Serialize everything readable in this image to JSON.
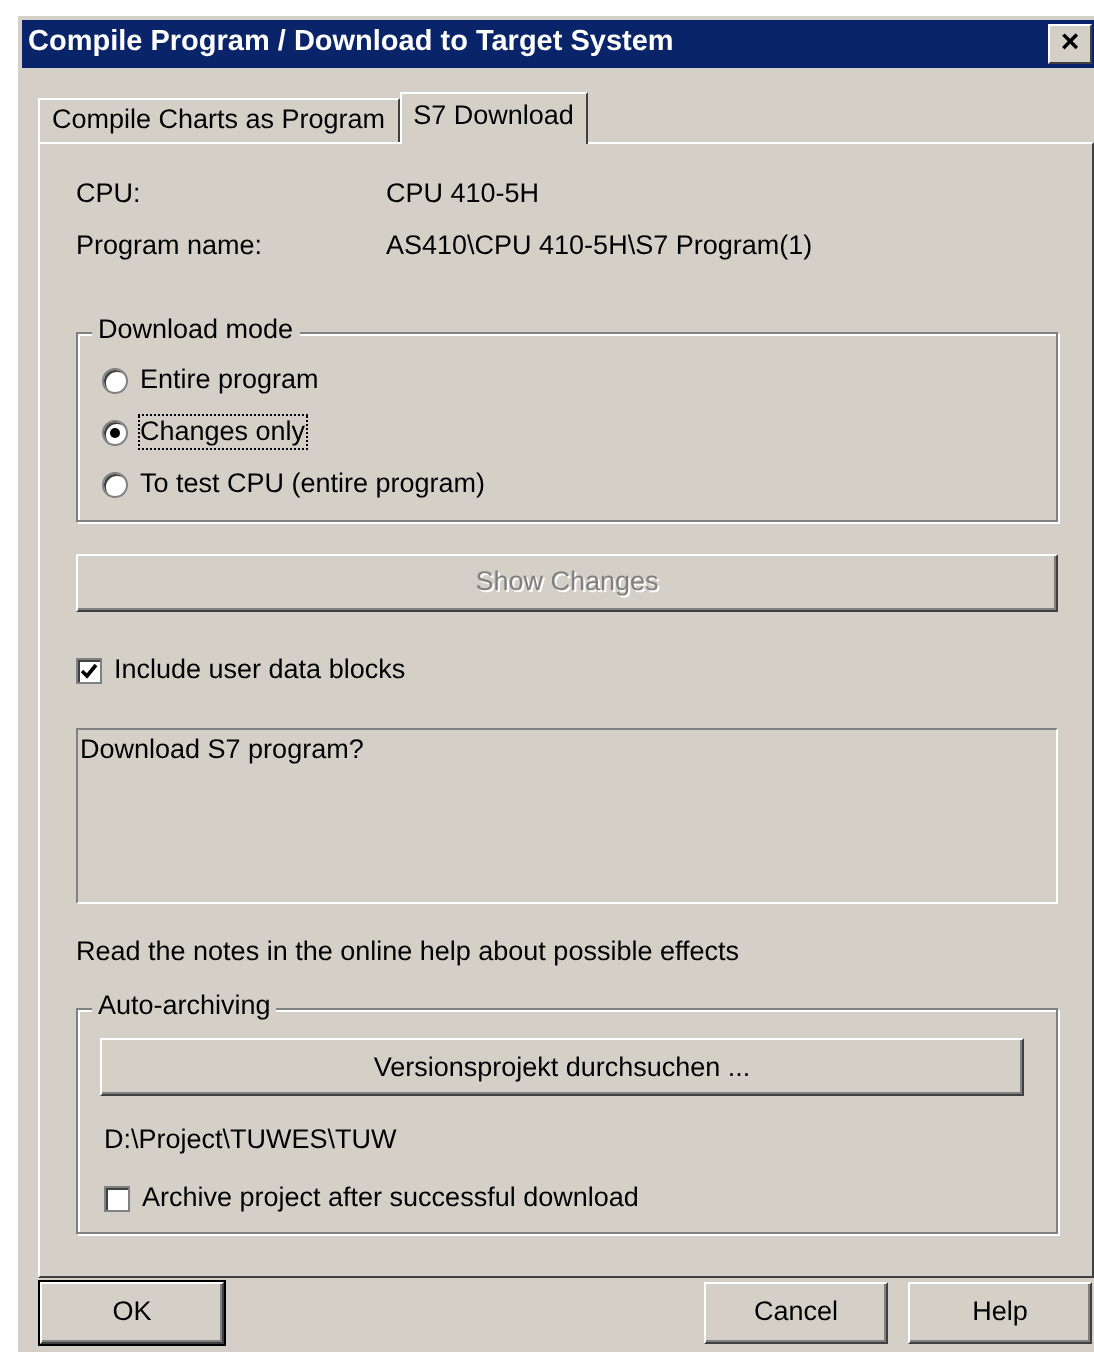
{
  "window": {
    "title": "Compile Program / Download to Target System",
    "close": "×"
  },
  "tabs": [
    {
      "label": "Compile Charts as Program",
      "selected": false
    },
    {
      "label": "S7 Download",
      "selected": true
    }
  ],
  "info": [
    {
      "label": "CPU:",
      "value": "CPU 410-5H"
    },
    {
      "label": "Program name:",
      "value": "AS410\\CPU 410-5H\\S7 Program(1)"
    }
  ],
  "download_mode": {
    "title": "Download mode",
    "options": [
      {
        "label": "Entire program",
        "selected": false,
        "focused": false
      },
      {
        "label": "Changes only",
        "selected": true,
        "focused": true
      },
      {
        "label": "To test CPU (entire program)",
        "selected": false,
        "focused": false
      }
    ]
  },
  "show_changes": {
    "label": "Show Changes",
    "disabled": true
  },
  "include_user_data_blocks": {
    "label": "Include user data blocks",
    "checked": true
  },
  "message": "Download S7 program?",
  "note": "Read the notes in the online help about possible effects",
  "auto_archiving": {
    "title": "Auto-archiving",
    "browse_button": "Versionsprojekt durchsuchen ...",
    "path": "D:\\Project\\TUWES\\TUW",
    "archive_after_download": {
      "label": "Archive project after successful download",
      "checked": false
    }
  },
  "buttons": [
    {
      "label": "OK",
      "default": true
    },
    {
      "label": "Cancel",
      "default": false
    },
    {
      "label": "Help",
      "default": false
    }
  ]
}
